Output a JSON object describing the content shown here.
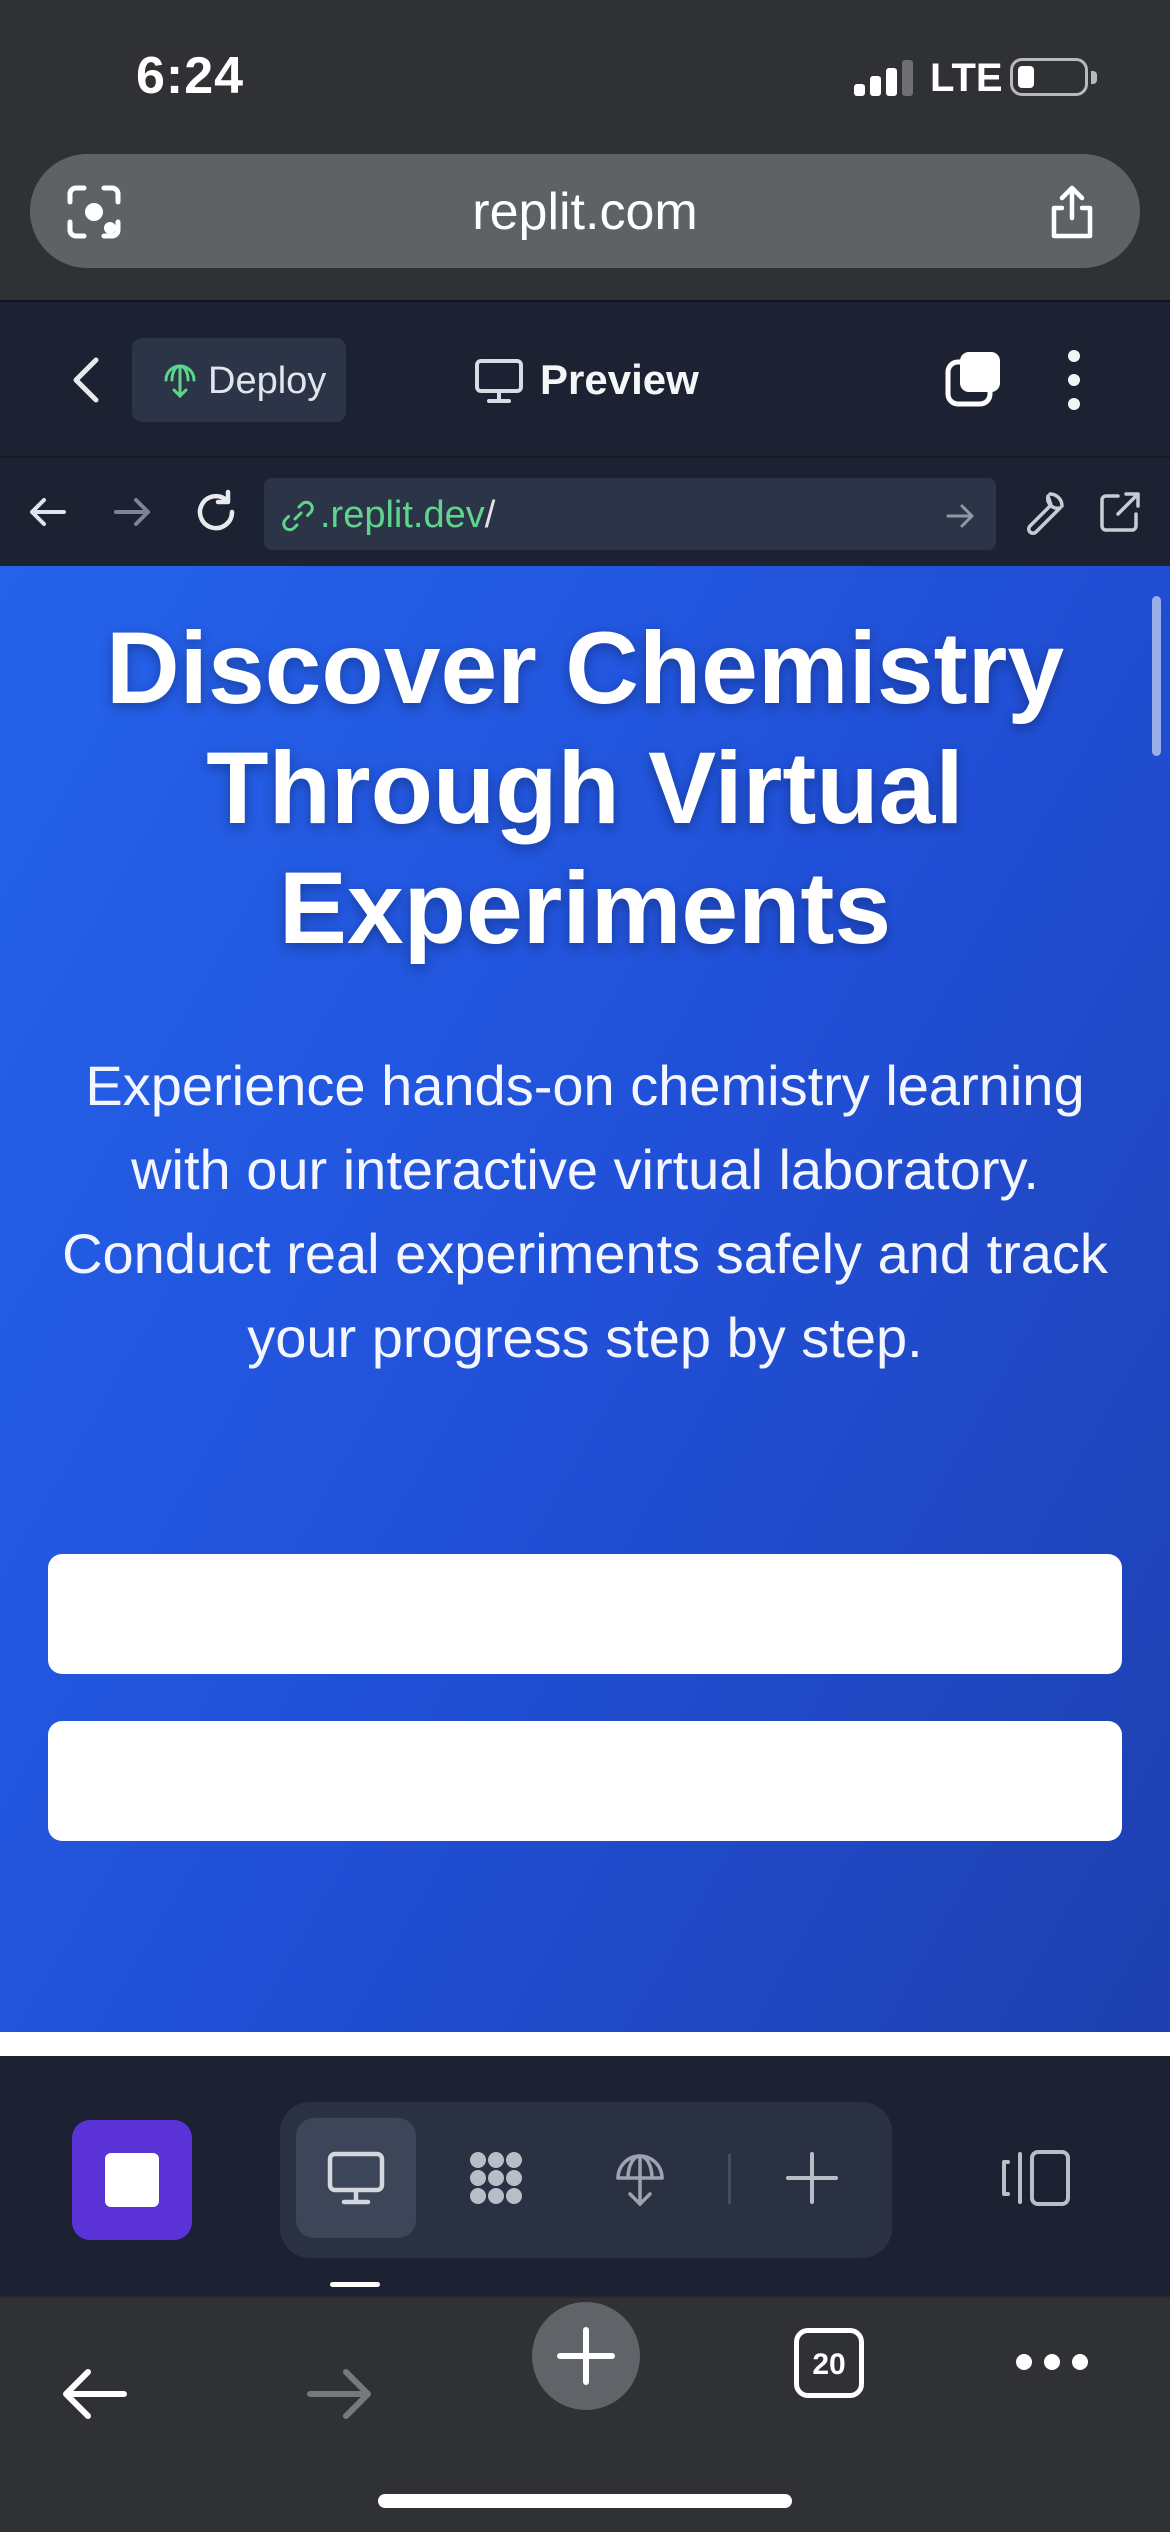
{
  "status_bar": {
    "time": "6:24",
    "network": "LTE"
  },
  "safari": {
    "url": "replit.com",
    "tab_count": "20"
  },
  "replit_header": {
    "deploy_label": "Deploy",
    "preview_label": "Preview"
  },
  "preview_toolbar": {
    "address_host": ".replit.dev",
    "address_path": "/"
  },
  "hero": {
    "title": "Discover Chemistry Through Virtual Experiments",
    "subtitle": "Experience hands-on chemistry learning with our interactive virtual laboratory. Conduct real experiments safely and track your progress step by step."
  },
  "colors": {
    "hero_gradient_start": "#2563eb",
    "hero_gradient_end": "#1e40af",
    "replit_bg": "#1c2232",
    "stop_button": "#5b33d6",
    "link_green": "#5ed58d"
  },
  "icons": {
    "url_pill_left": "screenshot-scan-icon",
    "url_pill_right": "share-icon",
    "dock_items": [
      "monitor-icon",
      "workflow-icon",
      "deploy-icon",
      "add-icon"
    ]
  }
}
